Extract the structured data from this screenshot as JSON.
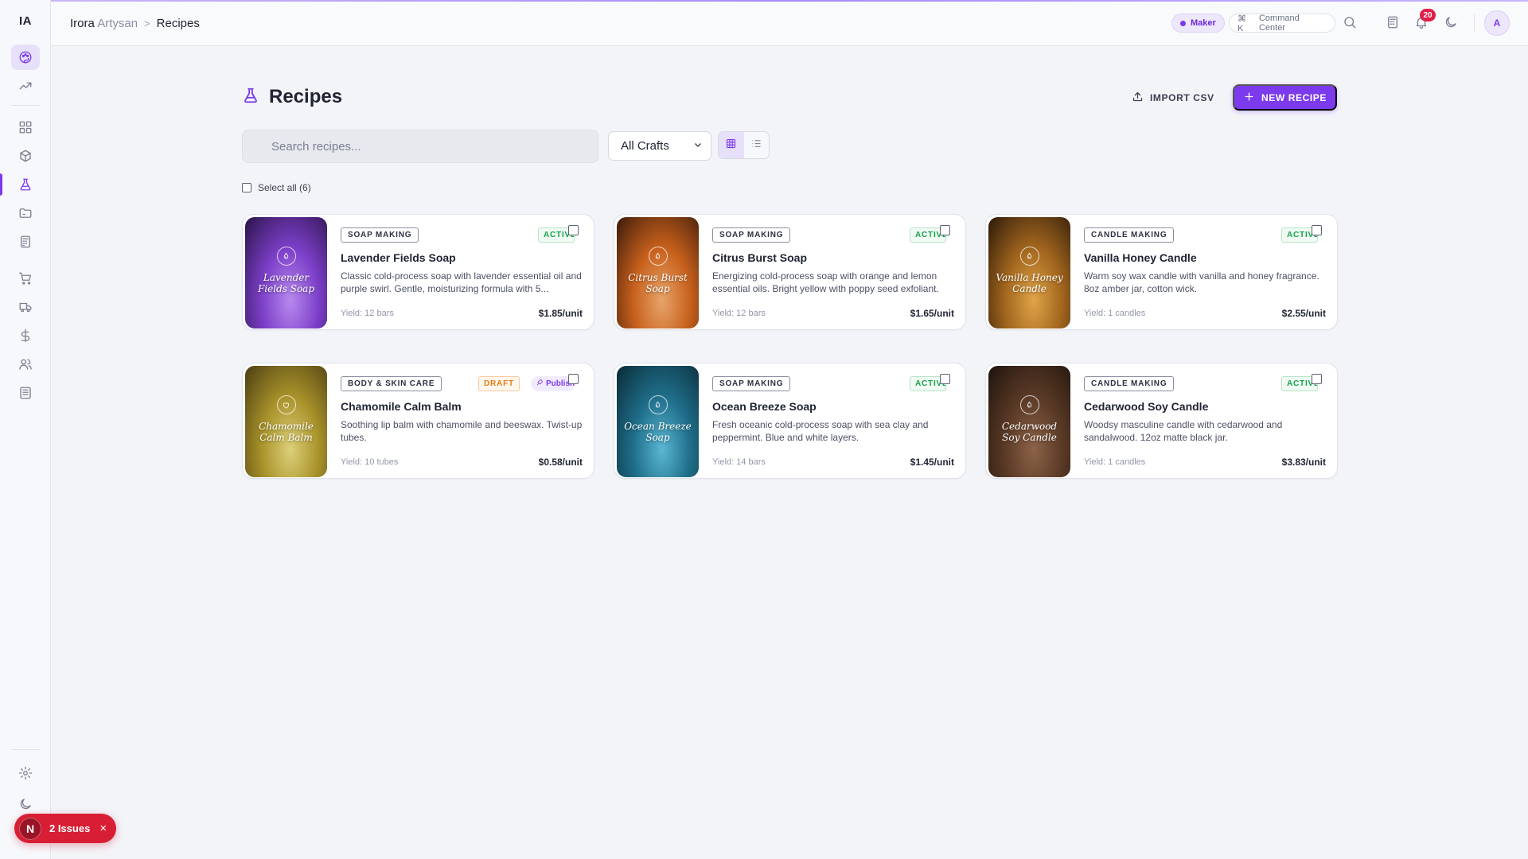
{
  "sidebar": {
    "logo": "IA"
  },
  "header": {
    "org_name": "Irora",
    "org_suffix": "Artysan",
    "separator": ">",
    "current": "Recipes",
    "role_badge": "Maker",
    "command_shortcut": "⌘ K",
    "command_label": "Command Center",
    "notification_count": "20",
    "avatar_initial": "A"
  },
  "page": {
    "title": "Recipes",
    "import_label": "IMPORT CSV",
    "new_label": "NEW RECIPE",
    "search_placeholder": "Search recipes...",
    "craft_filter": "All Crafts",
    "select_all": "Select all (6)"
  },
  "recipes": [
    {
      "thumb_name": "Lavender Fields Soap",
      "craft": "SOAP MAKING",
      "status": "ACTIVE",
      "name": "Lavender Fields Soap",
      "description": "Classic cold-process soap with lavender essential oil and purple swirl. Gentle, moisturizing formula with 5...",
      "yield": "Yield: 12 bars",
      "price": "$1.85/unit",
      "gradient": [
        "#2a1248",
        "#7b3fc8",
        "#b889ee"
      ]
    },
    {
      "thumb_name": "Citrus Burst Soap",
      "craft": "SOAP MAKING",
      "status": "ACTIVE",
      "name": "Citrus Burst Soap",
      "description": "Energizing cold-process soap with orange and lemon essential oils. Bright yellow with poppy seed exfoliant.",
      "yield": "Yield: 12 bars",
      "price": "$1.65/unit",
      "gradient": [
        "#3a1a0a",
        "#c7601c",
        "#e8a46a"
      ]
    },
    {
      "thumb_name": "Vanilla Honey Candle",
      "craft": "CANDLE MAKING",
      "status": "ACTIVE",
      "name": "Vanilla Honey Candle",
      "description": "Warm soy wax candle with vanilla and honey fragrance. 8oz amber jar, cotton wick.",
      "yield": "Yield: 1 candles",
      "price": "$2.55/unit",
      "gradient": [
        "#2a1808",
        "#a2661e",
        "#e0a449"
      ]
    },
    {
      "thumb_name": "Chamomile Calm Balm",
      "craft": "BODY & SKIN CARE",
      "status": "DRAFT",
      "publish": "Publish",
      "name": "Chamomile Calm Balm",
      "description": "Soothing lip balm with chamomile and beeswax. Twist-up tubes.",
      "yield": "Yield: 10 tubes",
      "price": "$0.58/unit",
      "gradient": [
        "#4a3c12",
        "#a8922a",
        "#ddd07a"
      ]
    },
    {
      "thumb_name": "Ocean Breeze Soap",
      "craft": "SOAP MAKING",
      "status": "ACTIVE",
      "name": "Ocean Breeze Soap",
      "description": "Fresh oceanic cold-process soap with sea clay and peppermint. Blue and white layers.",
      "yield": "Yield: 14 bars",
      "price": "$1.45/unit",
      "gradient": [
        "#0a2a36",
        "#1f6e8a",
        "#5ab7d2"
      ]
    },
    {
      "thumb_name": "Cedarwood Soy Candle",
      "craft": "CANDLE MAKING",
      "status": "ACTIVE",
      "name": "Cedarwood Soy Candle",
      "description": "Woodsy masculine candle with cedarwood and sandalwood. 12oz matte black jar.",
      "yield": "Yield: 1 candles",
      "price": "$3.83/unit",
      "gradient": [
        "#1e130d",
        "#5b3a26",
        "#8c6248"
      ]
    }
  ],
  "issues": {
    "badge": "N",
    "label": "2 Issues",
    "close": "×"
  },
  "colors": {
    "accent": "#7c3aed",
    "active_green": "#16a34a",
    "draft_orange": "#ea7a12",
    "issues_red": "#d81e34"
  }
}
